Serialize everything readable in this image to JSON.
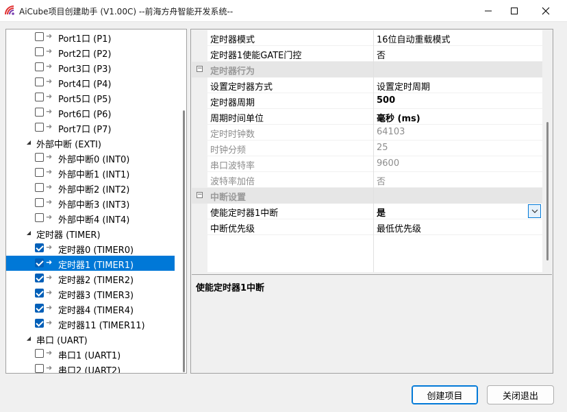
{
  "window": {
    "title": "AiCube项目创建助手 (V1.00C) --前海方舟智能开发系统--"
  },
  "tree": {
    "items": [
      {
        "label": "Port1口 (P1)",
        "level": 2,
        "checked": false
      },
      {
        "label": "Port2口 (P2)",
        "level": 2,
        "checked": false
      },
      {
        "label": "Port3口 (P3)",
        "level": 2,
        "checked": false
      },
      {
        "label": "Port4口 (P4)",
        "level": 2,
        "checked": false
      },
      {
        "label": "Port5口 (P5)",
        "level": 2,
        "checked": false
      },
      {
        "label": "Port6口 (P6)",
        "level": 2,
        "checked": false
      },
      {
        "label": "Port7口 (P7)",
        "level": 2,
        "checked": false
      },
      {
        "label": "外部中断 (EXTI)",
        "level": 1,
        "expanded": true
      },
      {
        "label": "外部中断0 (INT0)",
        "level": 2,
        "checked": false
      },
      {
        "label": "外部中断1 (INT1)",
        "level": 2,
        "checked": false
      },
      {
        "label": "外部中断2 (INT2)",
        "level": 2,
        "checked": false
      },
      {
        "label": "外部中断3 (INT3)",
        "level": 2,
        "checked": false
      },
      {
        "label": "外部中断4 (INT4)",
        "level": 2,
        "checked": false
      },
      {
        "label": "定时器 (TIMER)",
        "level": 1,
        "expanded": true
      },
      {
        "label": "定时器0 (TIMER0)",
        "level": 2,
        "checked": true
      },
      {
        "label": "定时器1 (TIMER1)",
        "level": 2,
        "checked": true,
        "selected": true
      },
      {
        "label": "定时器2 (TIMER2)",
        "level": 2,
        "checked": true
      },
      {
        "label": "定时器3 (TIMER3)",
        "level": 2,
        "checked": true
      },
      {
        "label": "定时器4 (TIMER4)",
        "level": 2,
        "checked": true
      },
      {
        "label": "定时器11 (TIMER11)",
        "level": 2,
        "checked": true
      },
      {
        "label": "串口 (UART)",
        "level": 1,
        "expanded": true
      },
      {
        "label": "串口1 (UART1)",
        "level": 2,
        "checked": false
      },
      {
        "label": "串口2 (UART2)",
        "level": 2,
        "checked": false
      }
    ]
  },
  "properties": {
    "rows": [
      {
        "kind": "prop",
        "name": "定时器模式",
        "value": "16位自动重载模式"
      },
      {
        "kind": "prop",
        "name": "定时器1使能GATE门控",
        "value": "否"
      },
      {
        "kind": "category",
        "name": "定时器行为"
      },
      {
        "kind": "prop",
        "name": "设置定时器方式",
        "value": "设置定时周期"
      },
      {
        "kind": "prop",
        "name": "定时器周期",
        "value": "500",
        "bold": true
      },
      {
        "kind": "prop",
        "name": "周期时间单位",
        "value": "毫秒 (ms)",
        "bold": true
      },
      {
        "kind": "prop",
        "name": "定时时钟数",
        "value": "64103",
        "disabled": true
      },
      {
        "kind": "prop",
        "name": "时钟分频",
        "value": "25",
        "disabled": true
      },
      {
        "kind": "prop",
        "name": "串口波特率",
        "value": "9600",
        "disabled": true
      },
      {
        "kind": "prop",
        "name": "波特率加倍",
        "value": "否",
        "disabled": true
      },
      {
        "kind": "category",
        "name": "中断设置"
      },
      {
        "kind": "prop",
        "name": "使能定时器1中断",
        "value": "是",
        "bold": true,
        "dropdown": true
      },
      {
        "kind": "prop",
        "name": "中断优先级",
        "value": "最低优先级"
      }
    ],
    "help_title": "使能定时器1中断"
  },
  "buttons": {
    "create": "创建项目",
    "exit": "关闭退出"
  },
  "colors": {
    "selection": "#0078d7",
    "checkbox_checked": "#005fb8"
  }
}
